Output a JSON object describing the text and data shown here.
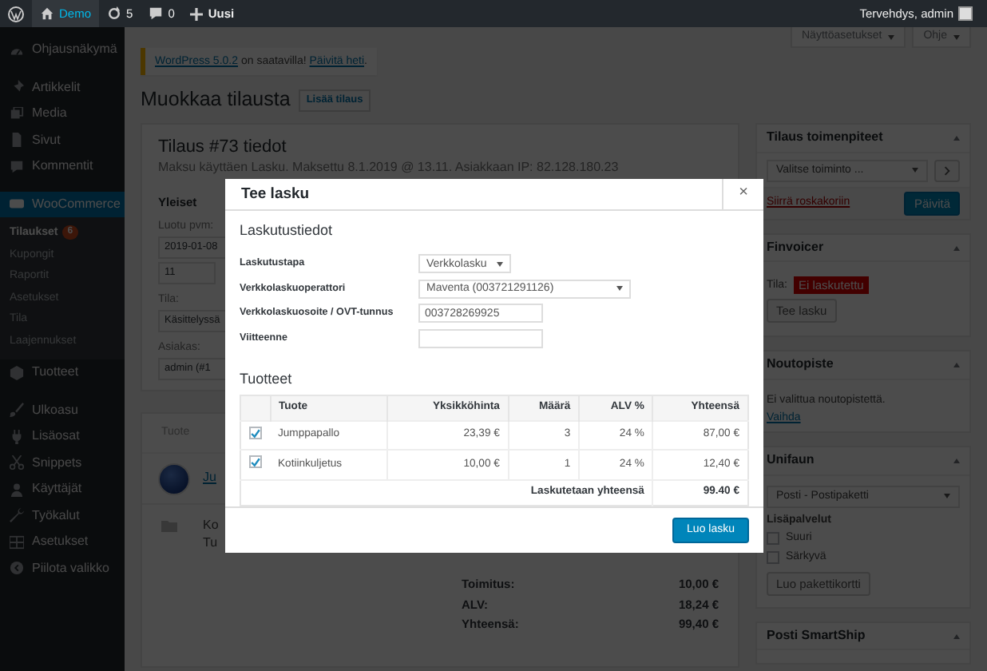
{
  "admin_bar": {
    "site": "Demo",
    "updates": "5",
    "comments": "0",
    "new": "Uusi",
    "greeting": "Tervehdys, admin"
  },
  "sidebar": {
    "groups": [
      [
        {
          "label": "Ohjausnäkymä",
          "selected": false
        }
      ],
      [
        {
          "label": "Artikkelit",
          "selected": false
        },
        {
          "label": "Media",
          "selected": false
        },
        {
          "label": "Sivut",
          "selected": false
        },
        {
          "label": "Kommentit",
          "selected": false
        }
      ],
      [
        {
          "label": "WooCommerce",
          "selected": true,
          "children": [
            {
              "label": "Tilaukset",
              "selected": true,
              "badge": "6"
            },
            {
              "label": "Kupongit",
              "selected": false
            },
            {
              "label": "Raportit",
              "selected": false
            },
            {
              "label": "Asetukset",
              "selected": false
            },
            {
              "label": "Tila",
              "selected": false
            },
            {
              "label": "Laajennukset",
              "selected": false
            }
          ]
        },
        {
          "label": "Tuotteet",
          "selected": false
        }
      ],
      [
        {
          "label": "Ulkoasu",
          "selected": false
        },
        {
          "label": "Lisäosat",
          "selected": false
        },
        {
          "label": "Snippets",
          "selected": false
        },
        {
          "label": "Käyttäjät",
          "selected": false
        },
        {
          "label": "Työkalut",
          "selected": false
        },
        {
          "label": "Asetukset",
          "selected": false
        },
        {
          "label": "Piilota valikko",
          "selected": false
        }
      ]
    ]
  },
  "screen_buttons": [
    "Näyttöasetukset",
    "Ohje"
  ],
  "notice": {
    "parts": [
      {
        "text": "WordPress 5.0.2",
        "link": true
      },
      {
        "text": " on saatavilla! ",
        "link": false
      },
      {
        "text": "Päivitä heti",
        "link": true
      },
      {
        "text": ".",
        "link": false
      }
    ]
  },
  "page": {
    "title": "Muokkaa tilausta",
    "add_button": "Lisää tilaus"
  },
  "order": {
    "title": "Tilaus #73 tiedot",
    "subtitle": "Maksu käyttäen Lasku. Maksettu 8.1.2019 @ 13.11. Asiakkaan IP: 82.128.180.23",
    "section": "Yleiset",
    "fields": [
      {
        "label": "Luotu pvm:",
        "values": [
          "2019-01-08",
          "11"
        ]
      },
      {
        "label": "Tila:",
        "values": [
          "Käsittelyssä"
        ]
      },
      {
        "label": "Asiakas:",
        "values": [
          "admin (#1"
        ]
      }
    ]
  },
  "items": {
    "column": "Tuote",
    "product_link": "Ju",
    "download_lines": [
      "Ko",
      "Tu"
    ]
  },
  "totals": [
    {
      "label": "Toimitus:",
      "value": "10,00 €"
    },
    {
      "label": "ALV:",
      "value": "18,24 €"
    },
    {
      "label": "Yhteensä:",
      "value": "99,40 €"
    }
  ],
  "boxes": [
    {
      "kind": "actions",
      "title": "Tilaus toimenpiteet",
      "select": "Valitse toiminto ...",
      "link": "Siirrä roskakoriin",
      "button": "Päivitä"
    },
    {
      "kind": "invoice",
      "title": "Finvoicer",
      "status_label": "Tila:",
      "status": "Ei laskutettu",
      "button": "Tee lasku"
    },
    {
      "kind": "pickup",
      "title": "Noutopiste",
      "text": "Ei valittua noutopistettä.",
      "link": "Vaihda"
    },
    {
      "kind": "shipping",
      "title": "Unifaun",
      "select": "Posti - Postipaketti",
      "options_label": "Lisäpalvelut",
      "options": [
        {
          "label": "Suuri",
          "checked": false
        },
        {
          "label": "Särkyvä",
          "checked": false
        }
      ],
      "button": "Luo pakettikortti"
    },
    {
      "kind": "plain",
      "title": "Posti SmartShip"
    }
  ],
  "modal": {
    "title": "Tee lasku",
    "close": "×",
    "section": "Laskutustiedot",
    "fields": [
      {
        "label": "Laskutustapa",
        "kind": "select",
        "value": "Verkkolasku"
      },
      {
        "label": "Verkkolaskuoperattori",
        "kind": "longselect",
        "value": "Maventa (003721291126)"
      },
      {
        "label": "Verkkolaskuosoite / OVT-tunnus",
        "kind": "text",
        "value": "003728269925"
      },
      {
        "label": "Viitteenne",
        "kind": "text"
      }
    ],
    "products_heading": "Tuotteet",
    "table": {
      "columns": [
        "Tuote",
        "Yksikköhinta",
        "Määrä",
        "ALV %",
        "Yhteensä"
      ],
      "rows": [
        {
          "checked": true,
          "cells": [
            "Jumppapallo",
            "23,39 €",
            "3",
            "24 %",
            "87,00 €"
          ]
        },
        {
          "checked": true,
          "cells": [
            "Kotiinkuljetus",
            "10,00 €",
            "1",
            "24 %",
            "12,40 €"
          ]
        }
      ],
      "total_label": "Laskutetaan yhteensä",
      "total_value": "99.40 €"
    },
    "submit": "Luo lasku"
  }
}
